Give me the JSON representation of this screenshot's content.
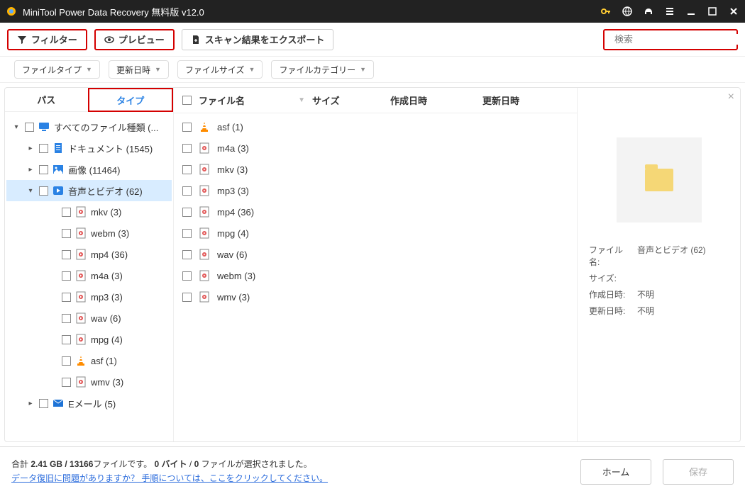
{
  "titlebar": {
    "title": "MiniTool Power Data Recovery 無料版 v12.0"
  },
  "toolbar": {
    "filter": "フィルター",
    "preview": "プレビュー",
    "export": "スキャン結果をエクスポート",
    "search_placeholder": "検索"
  },
  "filtersbar": {
    "file_type": "ファイルタイプ",
    "modified": "更新日時",
    "file_size": "ファイルサイズ",
    "category": "ファイルカテゴリー"
  },
  "tabs": {
    "path": "パス",
    "type": "タイプ"
  },
  "tree": {
    "all": "すべてのファイル種類 (...",
    "documents": "ドキュメント (1545)",
    "images": "画像 (11464)",
    "audio_video": "音声とビデオ (62)",
    "email": "Eメール (5)",
    "leaves": {
      "mkv": "mkv (3)",
      "webm": "webm (3)",
      "mp4": "mp4 (36)",
      "m4a": "m4a (3)",
      "mp3": "mp3 (3)",
      "wav": "wav (6)",
      "mpg": "mpg (4)",
      "asf": "asf (1)",
      "wmv": "wmv (3)"
    }
  },
  "list": {
    "headers": {
      "name": "ファイル名",
      "size": "サイズ",
      "created": "作成日時",
      "modified": "更新日時"
    },
    "rows": [
      {
        "name": "asf (1)",
        "icon": "vlc"
      },
      {
        "name": "m4a (3)",
        "icon": "media"
      },
      {
        "name": "mkv (3)",
        "icon": "media"
      },
      {
        "name": "mp3 (3)",
        "icon": "media"
      },
      {
        "name": "mp4 (36)",
        "icon": "media"
      },
      {
        "name": "mpg (4)",
        "icon": "media"
      },
      {
        "name": "wav (6)",
        "icon": "media"
      },
      {
        "name": "webm (3)",
        "icon": "media"
      },
      {
        "name": "wmv (3)",
        "icon": "media"
      }
    ]
  },
  "details": {
    "filename_label": "ファイル名:",
    "filename_value": "音声とビデオ (62)",
    "size_label": "サイズ:",
    "size_value": "",
    "created_label": "作成日時:",
    "created_value": "不明",
    "modified_label": "更新日時:",
    "modified_value": "不明"
  },
  "footer": {
    "summary_a": "合計 ",
    "summary_b": "2.41 GB / 13166",
    "summary_c": "ファイルです。 ",
    "summary_d": "0 バイト",
    "summary_e": " / ",
    "summary_f": "0",
    "summary_g": " ファイルが選択されました。",
    "help": "データ復旧に問題がありますか？ 手順については、ここをクリックしてください。",
    "home": "ホーム",
    "save": "保存"
  }
}
